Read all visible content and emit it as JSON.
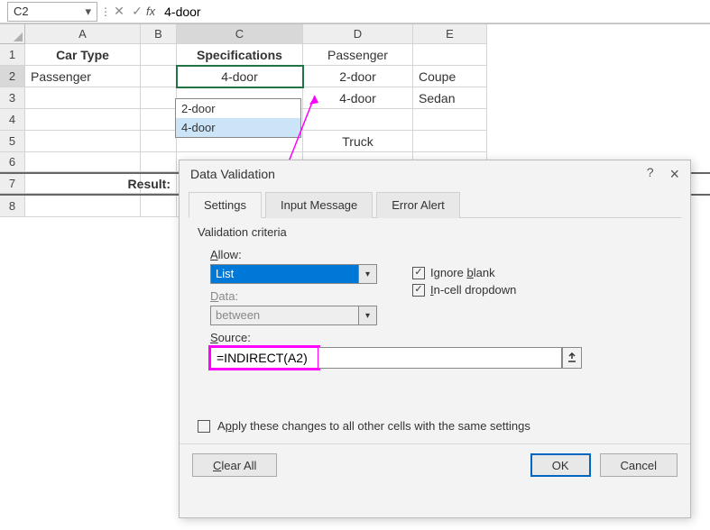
{
  "namebox": "C2",
  "formula": "4-door",
  "cols": {
    "A": 128,
    "B": 40,
    "C": 140,
    "D": 122,
    "E": 82
  },
  "headers": [
    "A",
    "B",
    "C",
    "D",
    "E"
  ],
  "rows": [
    "1",
    "2",
    "3",
    "4",
    "5",
    "6",
    "7",
    "8"
  ],
  "cells": {
    "A1": "Car Type",
    "C1": "Specifications",
    "D1": "Passenger",
    "A2": "Passenger",
    "C2": "4-door",
    "D2": "2-door",
    "E2": "Coupe",
    "D3": "4-door",
    "E3": "Sedan",
    "D5": "Truck",
    "B7": "Result:"
  },
  "dropdown": {
    "items": [
      "2-door",
      "4-door"
    ],
    "selected": 1
  },
  "dialog": {
    "title": "Data Validation",
    "help": "?",
    "close": "×",
    "tabs": {
      "settings": "Settings",
      "input": "Input Message",
      "error": "Error Alert"
    },
    "criteria_legend": "Validation criteria",
    "allow_label": "Allow:",
    "allow_value": "List",
    "data_label": "Data:",
    "data_value": "between",
    "ignore_blank": "Ignore blank",
    "incell": "In-cell dropdown",
    "source_label": "Source:",
    "source_value": "=INDIRECT(A2)",
    "apply_all": "Apply these changes to all other cells with the same settings",
    "clear": "Clear All",
    "ok": "OK",
    "cancel": "Cancel"
  },
  "chart_data": null
}
